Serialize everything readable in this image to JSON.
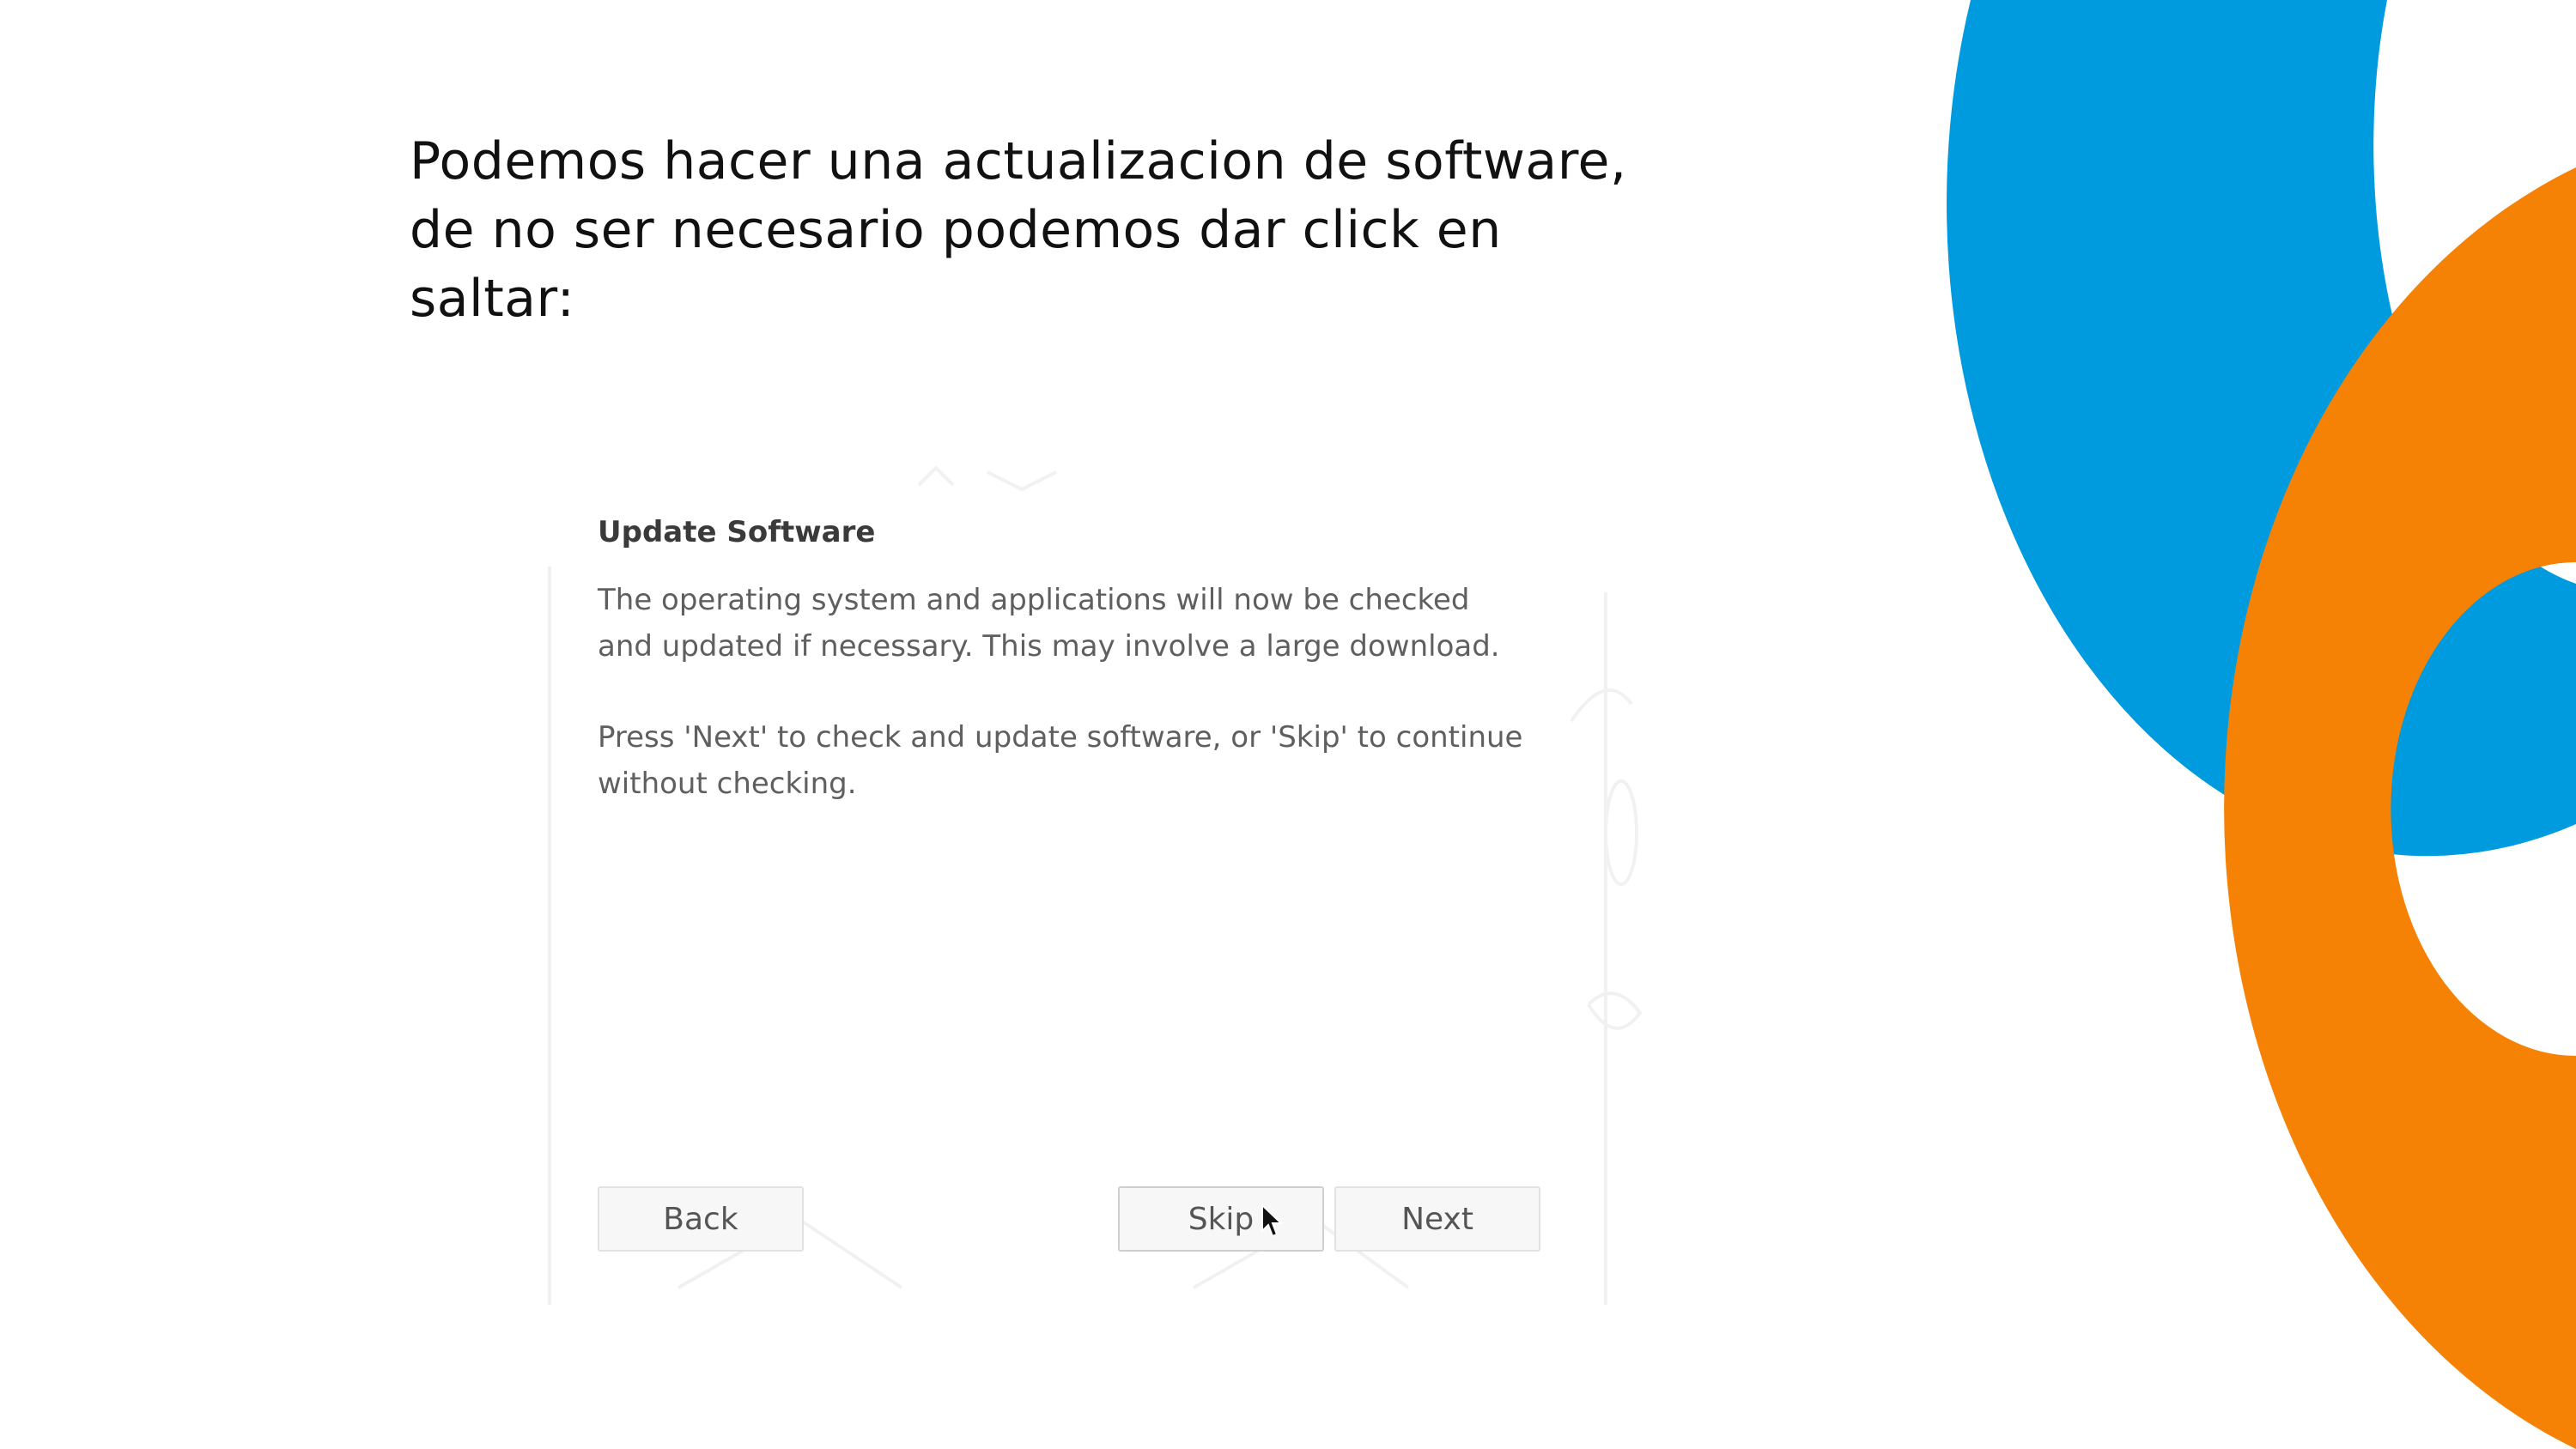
{
  "slide": {
    "heading_lines": [
      "Podemos hacer una actualizacion de software,",
      "de no ser necesario podemos dar click en",
      "saltar:"
    ]
  },
  "colors": {
    "blue_accent": "#009ADE",
    "orange_accent": "#F58205",
    "background": "#ffffff"
  },
  "dialog": {
    "title": "Update Software",
    "paragraph1_lines": [
      "The operating system and applications will now be checked",
      "and updated if necessary. This may involve a large download."
    ],
    "paragraph2_lines": [
      "Press 'Next' to check and update software, or 'Skip' to continue",
      "without checking."
    ],
    "buttons": {
      "back": "Back",
      "skip": "Skip",
      "next": "Next"
    },
    "icons": {
      "cursor": "mouse-pointer-icon"
    }
  }
}
